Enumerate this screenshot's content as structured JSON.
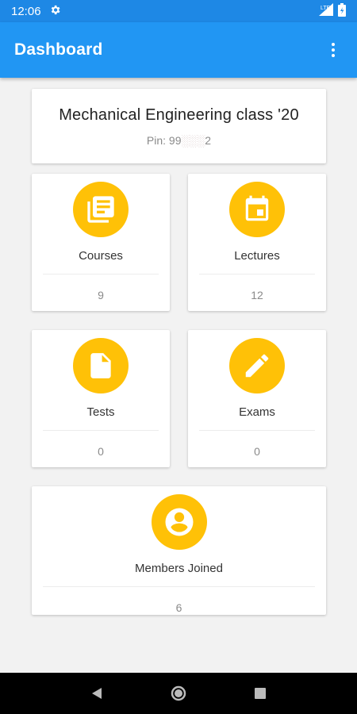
{
  "status_bar": {
    "time": "12:06",
    "icons": [
      "settings-icon",
      "signal-icon",
      "battery-icon"
    ]
  },
  "app_bar": {
    "title": "Dashboard",
    "menu_icon": "more-vert-icon"
  },
  "class_info": {
    "name": "Mechanical Engineering class '20",
    "pin_label": "Pin: 99",
    "pin_hidden": "░░░",
    "pin_end": "2"
  },
  "stats": [
    {
      "label": "Courses",
      "value": "9",
      "icon": "library-books-icon"
    },
    {
      "label": "Lectures",
      "value": "12",
      "icon": "calendar-icon"
    },
    {
      "label": "Tests",
      "value": "0",
      "icon": "document-icon"
    },
    {
      "label": "Exams",
      "value": "0",
      "icon": "pencil-icon"
    },
    {
      "label": "Members Joined",
      "value": "6",
      "icon": "account-circle-icon"
    }
  ],
  "nav_bar": {
    "buttons": [
      "back-icon",
      "home-icon",
      "recents-icon"
    ]
  },
  "colors": {
    "app_bar": "#2196f3",
    "status_bar": "#1e88e5",
    "accent": "#ffc107",
    "background": "#f2f2f2"
  }
}
